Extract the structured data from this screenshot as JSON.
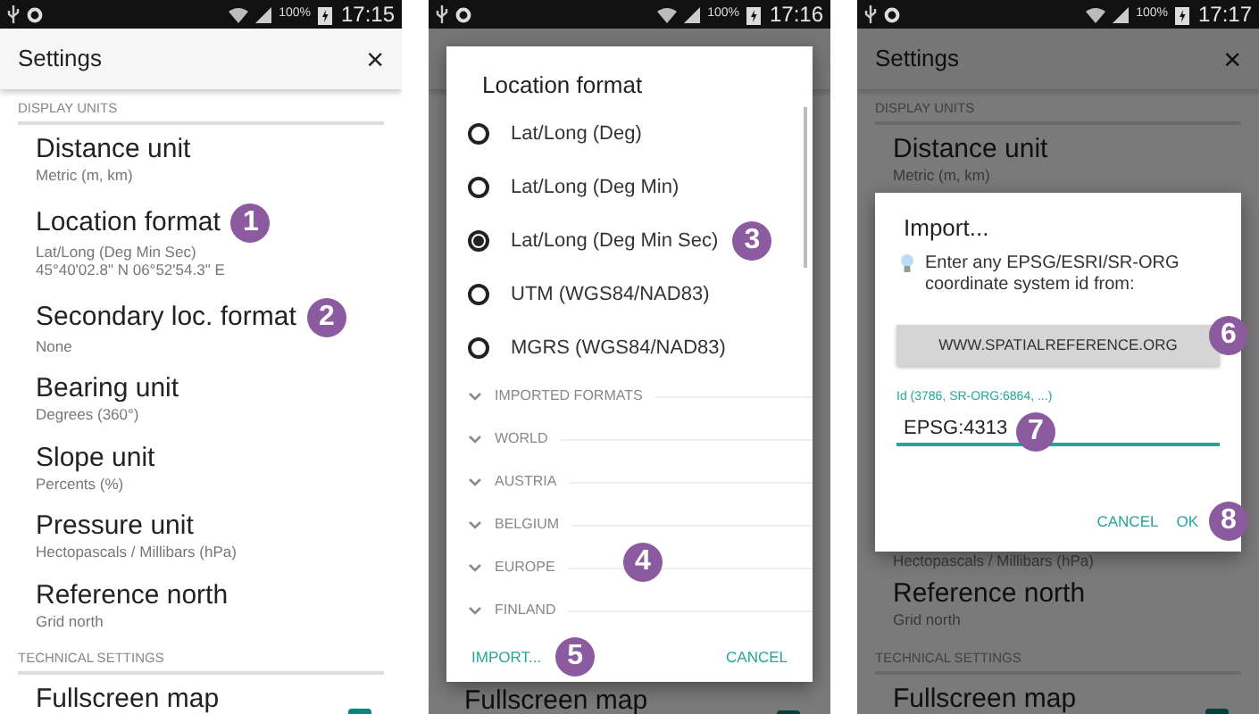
{
  "panels": [
    {
      "status_bar": {
        "battery": "100%",
        "time": "17:15"
      },
      "settings": {
        "title": "Settings",
        "close": "×",
        "sections": [
          {
            "header": "DISPLAY UNITS",
            "items": [
              {
                "title": "Distance unit",
                "summary": [
                  "Metric (m, km)"
                ]
              },
              {
                "title": "Location format",
                "summary": [
                  "Lat/Long (Deg Min Sec)",
                  "45°40'02.8\" N 06°52'54.3\" E"
                ],
                "badge": "1"
              },
              {
                "title": "Secondary loc. format",
                "summary": [
                  "None"
                ],
                "badge": "2"
              },
              {
                "title": "Bearing unit",
                "summary": [
                  "Degrees (360°)"
                ]
              },
              {
                "title": "Slope unit",
                "summary": [
                  "Percents (%)"
                ]
              },
              {
                "title": "Pressure unit",
                "summary": [
                  "Hectopascals / Millibars (hPa)"
                ]
              },
              {
                "title": "Reference north",
                "summary": [
                  "Grid north"
                ]
              }
            ]
          },
          {
            "header": "TECHNICAL SETTINGS",
            "items": [
              {
                "title": "Fullscreen map",
                "checked": true
              }
            ]
          }
        ]
      }
    },
    {
      "status_bar": {
        "battery": "100%",
        "time": "17:16"
      },
      "settings": {
        "sections": [
          {
            "items": [
              {
                "title": "Fullscreen map",
                "checked": true
              }
            ]
          }
        ]
      },
      "dialog": {
        "kind": "choice",
        "title": "Location format",
        "options": [
          {
            "label": "Lat/Long (Deg)",
            "selected": false
          },
          {
            "label": "Lat/Long (Deg Min)",
            "selected": false
          },
          {
            "label": "Lat/Long (Deg Min Sec)",
            "selected": true,
            "badge": "3"
          },
          {
            "label": "UTM (WGS84/NAD83)",
            "selected": false
          },
          {
            "label": "MGRS (WGS84/NAD83)",
            "selected": false
          }
        ],
        "groups": [
          {
            "label": "IMPORTED FORMATS",
            "expanded": false
          },
          {
            "label": "WORLD",
            "expanded": false
          },
          {
            "label": "AUSTRIA",
            "expanded": false
          },
          {
            "label": "BELGIUM",
            "expanded": false
          },
          {
            "label": "EUROPE",
            "expanded": false
          },
          {
            "label": "FINLAND",
            "expanded": false
          }
        ],
        "groups_badge": "4",
        "buttons": [
          {
            "label": "IMPORT...",
            "badge": "5"
          },
          {
            "label": "CANCEL"
          }
        ]
      }
    },
    {
      "status_bar": {
        "battery": "100%",
        "time": "17:17"
      },
      "settings": {
        "title": "Settings",
        "close": "×",
        "sections": [
          {
            "header": "DISPLAY UNITS",
            "items": [
              {
                "title": "Distance unit",
                "summary": [
                  "Metric (m, km)"
                ]
              },
              {
                "summary": [
                  "Hectopascals / Millibars (hPa)"
                ]
              },
              {
                "title": "Reference north",
                "summary": [
                  "Grid north"
                ]
              }
            ]
          },
          {
            "header": "TECHNICAL SETTINGS",
            "items": [
              {
                "title": "Fullscreen map",
                "checked": true
              }
            ]
          }
        ]
      },
      "dialog": {
        "kind": "import",
        "title": "Import...",
        "hint": "Enter any EPSG/ESRI/SR-ORG coordinate system id from:",
        "link_button": {
          "label": "WWW.SPATIALREFERENCE.ORG",
          "badge": "6"
        },
        "field": {
          "label": "Id (3786, SR-ORG:6864, ...)",
          "value": "EPSG:4313",
          "badge": "7"
        },
        "buttons": [
          {
            "label": "CANCEL"
          },
          {
            "label": "OK",
            "badge": "8"
          }
        ]
      }
    }
  ]
}
